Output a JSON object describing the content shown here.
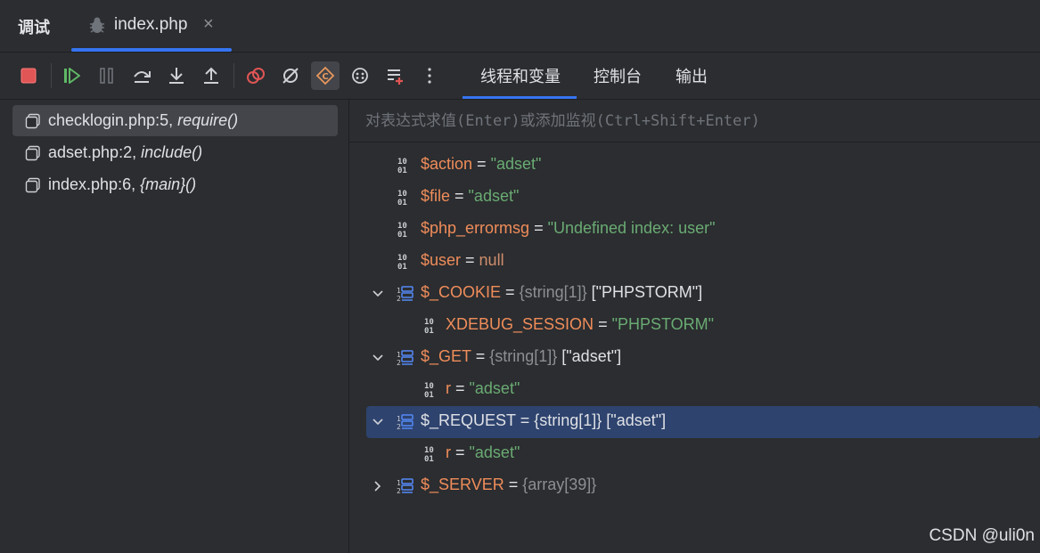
{
  "window": {
    "title": "调试"
  },
  "tab": {
    "label": "index.php",
    "close": "×"
  },
  "toolbar": {
    "buttons": [
      {
        "name": "stop-icon"
      },
      {
        "name": "resume-icon"
      },
      {
        "name": "pause-icon"
      },
      {
        "name": "step-over-icon"
      },
      {
        "name": "step-into-icon"
      },
      {
        "name": "step-out-icon"
      },
      {
        "name": "breakpoints-icon"
      },
      {
        "name": "mute-breakpoints-icon"
      },
      {
        "name": "break-on-first-line-icon"
      },
      {
        "name": "settings-icon"
      },
      {
        "name": "add-watch-icon"
      },
      {
        "name": "more-icon"
      }
    ],
    "tabs": [
      "线程和变量",
      "控制台",
      "输出"
    ]
  },
  "frames": [
    {
      "file": "checklogin.php:5,",
      "fn": "require()"
    },
    {
      "file": "adset.php:2,",
      "fn": "include()"
    },
    {
      "file": "index.php:6,",
      "fn": "{main}()"
    }
  ],
  "eval": {
    "placeholder": "对表达式求值(Enter)或添加监视(Ctrl+Shift+Enter)"
  },
  "variables": [
    {
      "name": "$action",
      "eq": " = ",
      "value": "\"adset\""
    },
    {
      "name": "$file",
      "eq": " = ",
      "value": "\"adset\""
    },
    {
      "name": "$php_errormsg",
      "eq": " = ",
      "value": "\"Undefined index: user\""
    },
    {
      "name": "$user",
      "eq": " = ",
      "value": "null"
    },
    {
      "name": "$_COOKIE",
      "eq": " = ",
      "type": "{string[1]}",
      "preview": " [\"PHPSTORM\"]"
    },
    {
      "name": "XDEBUG_SESSION",
      "eq": " = ",
      "value": "\"PHPSTORM\""
    },
    {
      "name": "$_GET",
      "eq": " = ",
      "type": "{string[1]}",
      "preview": " [\"adset\"]"
    },
    {
      "name": "r",
      "eq": " = ",
      "value": "\"adset\""
    },
    {
      "name": "$_REQUEST",
      "eq": " = ",
      "type": "{string[1]}",
      "preview": " [\"adset\"]"
    },
    {
      "name": "r",
      "eq": " = ",
      "value": "\"adset\""
    },
    {
      "name": "$_SERVER",
      "eq": " = ",
      "type": "{array[39]}"
    }
  ],
  "watermark": "CSDN @uli0n",
  "colors": {
    "accent": "#3574f0",
    "selection": "#2e436e",
    "string": "#6aab73",
    "name": "#f08d5a"
  }
}
